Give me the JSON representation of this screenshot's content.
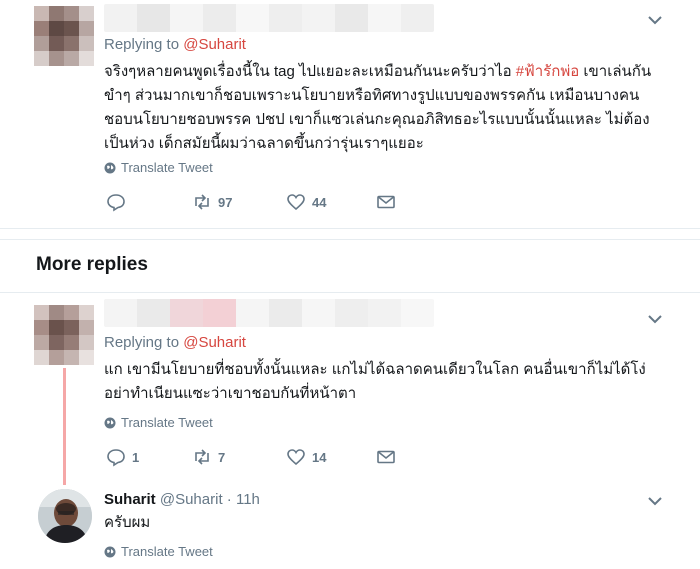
{
  "tweet1": {
    "replying_prefix": "Replying to",
    "replying_handle": "@Suharit",
    "text_line1_a": "จริงๆหลายคนพูดเรื่องนี้ใน tag ไปแยอะละเหมือนกันนะครับว่าไอ ",
    "hashtag": "#ฟ้ารักพ่อ",
    "text_line1_b": " เขาเล่นกัน",
    "text_rest": "ขำๆ ส่วนมากเขาก็ชอบเพราะนโยบายหรือทิศทางรูปแบบของพรรคกัน เหมือนบางคนชอบนโยบายชอบพรรค ปชป เขาก็แซวเล่นกะคุณอภิสิทธอะไรแบบนั้นนั้นแหละ  ไม่ต้องเป็นห่วง เด็กสมัยนี้ผมว่าฉลาดขึ้นกว่ารุ่นเราๆแยอะ",
    "translate_label": "Translate Tweet",
    "replies_count": "",
    "retweets_count": "97",
    "likes_count": "44"
  },
  "more_replies": {
    "title": "More replies"
  },
  "tweet2": {
    "replying_prefix": "Replying to",
    "replying_handle": "@Suharit",
    "text": "แก เขามีนโยบายที่ชอบทั้งนั้นแหละ แกไม่ได้ฉลาดคนเดียวในโลก คนอื่นเขาก็ไม่ได้โง่ อย่าทำเนียนแซะว่าเขาชอบกันที่หน้าตา",
    "translate_label": "Translate Tweet",
    "replies_count": "1",
    "retweets_count": "7",
    "likes_count": "14"
  },
  "tweet3": {
    "author_name": "Suharit",
    "author_handle": "@Suharit",
    "separator": " · ",
    "time": "11h",
    "text": "ครับผม",
    "translate_label": "Translate Tweet"
  },
  "colors": {
    "accent": "#d6463f",
    "muted": "#657786",
    "thread_line": "#f5a7a7",
    "divider": "#e6ecf0"
  },
  "icons": {
    "reply": "reply-icon",
    "retweet": "retweet-icon",
    "like": "heart-icon",
    "dm": "envelope-icon",
    "globe": "globe-icon",
    "caret": "chevron-down-icon"
  }
}
